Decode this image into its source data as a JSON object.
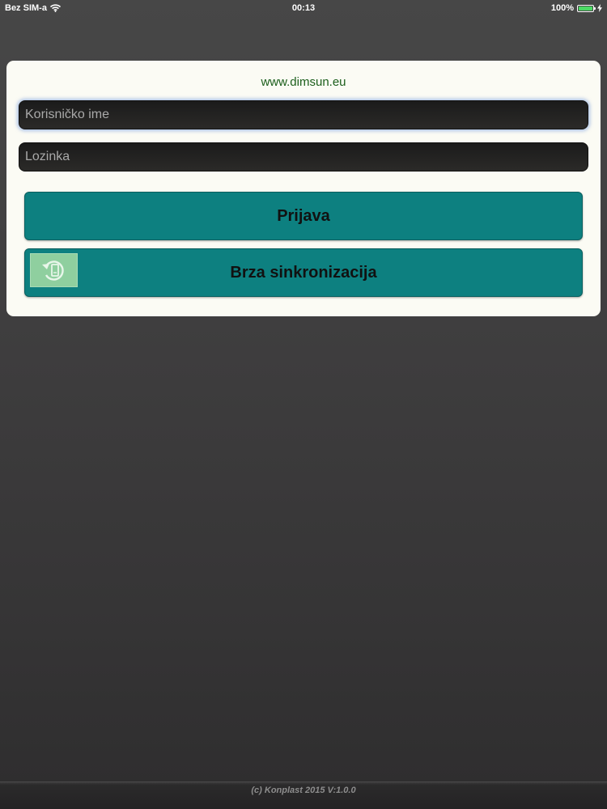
{
  "status_bar": {
    "carrier": "Bez SIM-a",
    "time": "00:13",
    "battery": "100%",
    "icons": [
      "wifi-icon",
      "battery-icon",
      "charging-icon"
    ]
  },
  "login": {
    "site": "www.dimsun.eu",
    "username_placeholder": "Korisničko ime",
    "username_value": "",
    "password_placeholder": "Lozinka",
    "password_value": "",
    "login_button": "Prijava",
    "sync_button": "Brza sinkronizacija",
    "sync_icon": "sync-icon"
  },
  "footer": {
    "text": "(c) Konplast 2015 V:1.0.0"
  },
  "colors": {
    "panel": "#fbfbf4",
    "button": "#0d8080",
    "site_text": "#1b5e1b",
    "battery": "#4cd964",
    "sync_icon_bg": "#8fcf9f"
  }
}
